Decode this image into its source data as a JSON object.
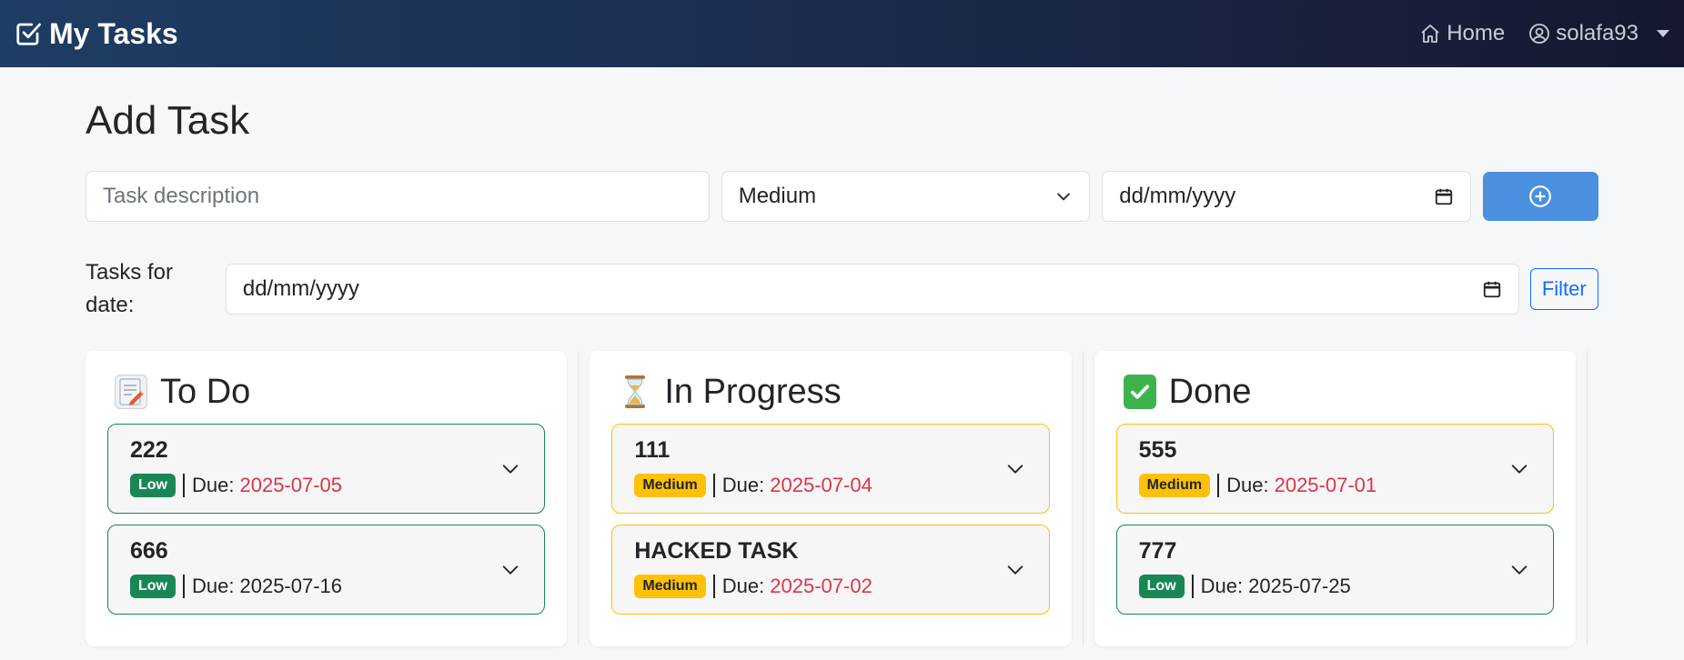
{
  "navbar": {
    "brand": "My Tasks",
    "home_label": "Home",
    "user_label": "solafa93"
  },
  "page_title": "Add Task",
  "add_form": {
    "description_placeholder": "Task description",
    "priority_value": "Medium",
    "date_placeholder": "dd/mm/yyyy"
  },
  "filter": {
    "label": "Tasks for date:",
    "date_placeholder": "dd/mm/yyyy",
    "button_label": "Filter"
  },
  "columns": [
    {
      "title": "To Do",
      "icon": "memo-icon",
      "cards": [
        {
          "title": "222",
          "priority": "Low",
          "due_label": "Due:",
          "due": "2025-07-05",
          "overdue": true
        },
        {
          "title": "666",
          "priority": "Low",
          "due_label": "Due:",
          "due": "2025-07-16",
          "overdue": false
        }
      ]
    },
    {
      "title": "In Progress",
      "icon": "hourglass-icon",
      "cards": [
        {
          "title": "111",
          "priority": "Medium",
          "due_label": "Due:",
          "due": "2025-07-04",
          "overdue": true
        },
        {
          "title": "HACKED TASK",
          "priority": "Medium",
          "due_label": "Due:",
          "due": "2025-07-02",
          "overdue": true
        }
      ]
    },
    {
      "title": "Done",
      "icon": "check-mark-button-icon",
      "cards": [
        {
          "title": "555",
          "priority": "Medium",
          "due_label": "Due:",
          "due": "2025-07-01",
          "overdue": true
        },
        {
          "title": "777",
          "priority": "Low",
          "due_label": "Due:",
          "due": "2025-07-25",
          "overdue": false
        }
      ]
    }
  ],
  "colors": {
    "primary": "#4a8fe0",
    "low": "#198754",
    "medium": "#ffc107",
    "overdue": "#dc3545"
  }
}
